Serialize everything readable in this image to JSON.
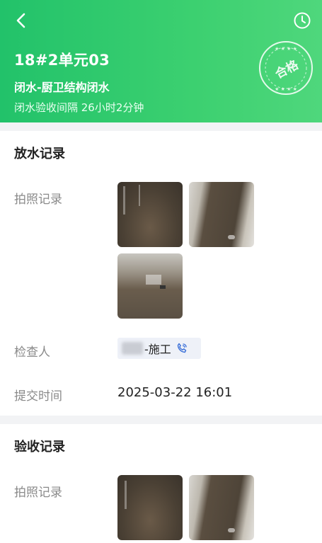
{
  "header": {
    "title": "18#2单元03",
    "subtitle": "闭水-厨卫结构闭水",
    "interval": "闭水验收间隔 26小时2分钟",
    "stamp": "合格"
  },
  "drain_record": {
    "section_title": "放水记录",
    "photo_label": "拍照记录",
    "inspector_label": "检查人",
    "inspector_name": "-施工",
    "submit_label": "提交时间",
    "submit_time": "2025-03-22 16:01"
  },
  "acceptance_record": {
    "section_title": "验收记录",
    "photo_label": "拍照记录"
  },
  "colors": {
    "header": "#2ec76d",
    "accent_blue": "#3a6fd8"
  },
  "icons": [
    "back-icon",
    "clock-icon",
    "phone-icon"
  ]
}
